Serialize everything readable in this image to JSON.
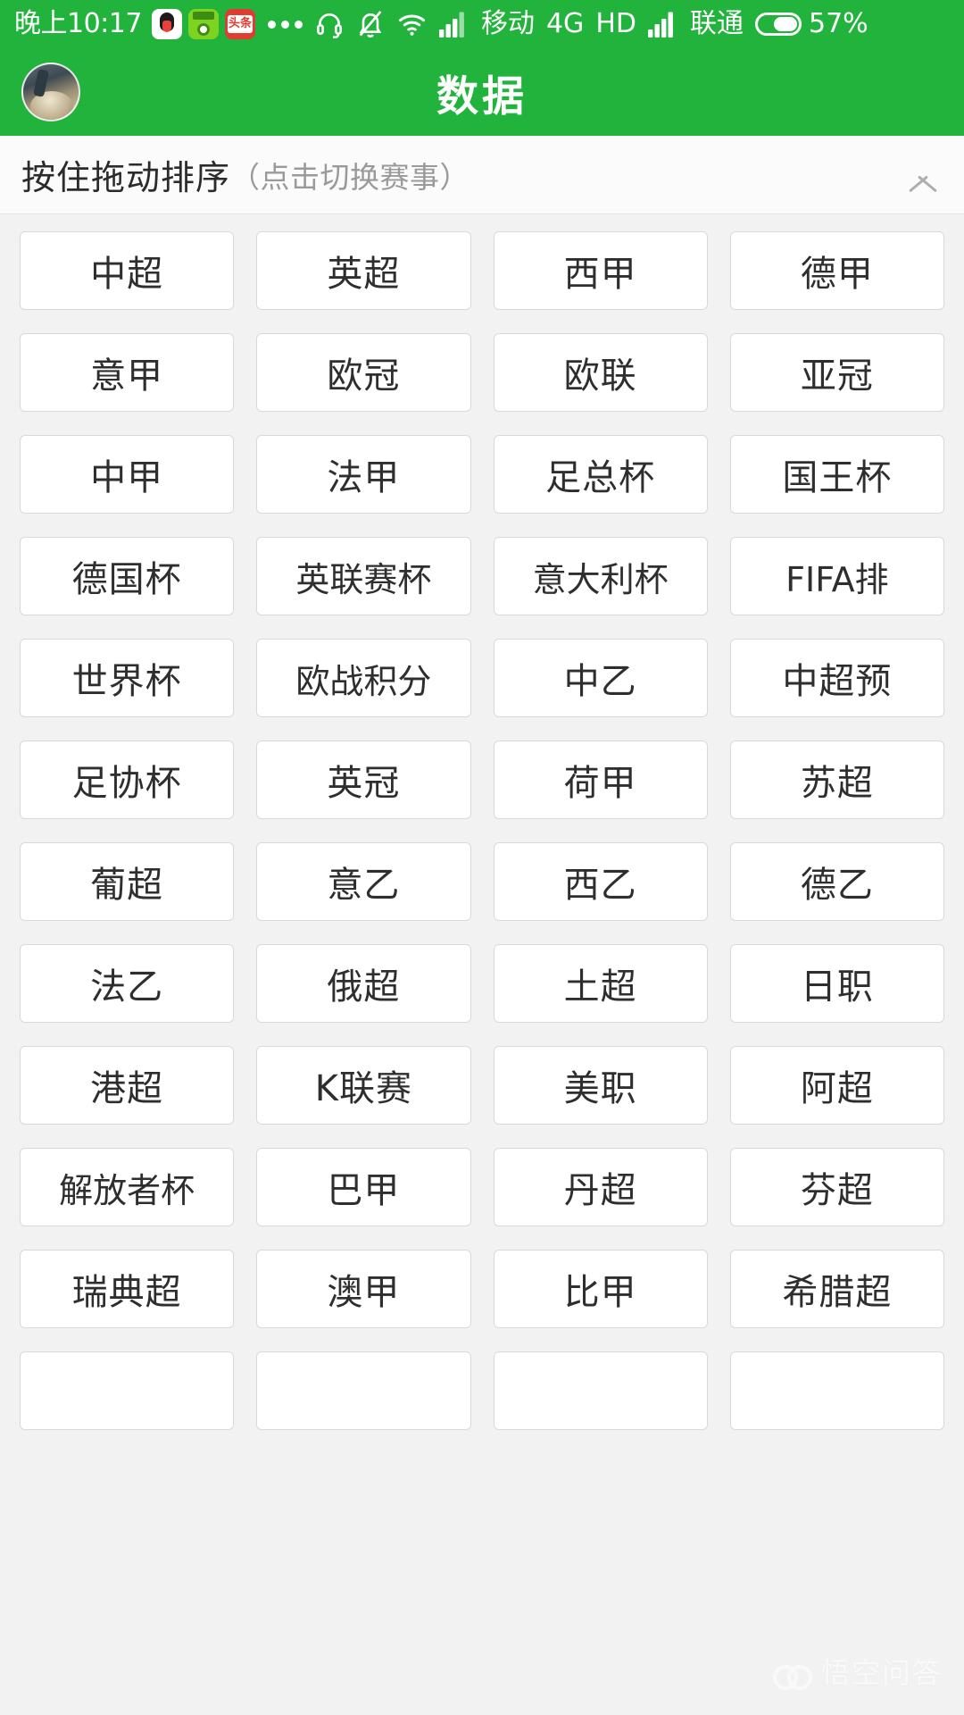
{
  "status_bar": {
    "clock": "晚上10:17",
    "app_icons": [
      "qq-icon",
      "green-app-icon",
      "toutiao-icon"
    ],
    "overflow": "more-dots-icon",
    "headset_icon": "headset-icon",
    "mute_icon": "bell-muted-icon",
    "wifi_icon": "wifi-icon",
    "signal1_icon": "signal-bars-icon",
    "carrier1": "移动",
    "network": "4G",
    "hd": "HD",
    "signal2_icon": "signal-bars-icon",
    "carrier2": "联通",
    "battery_icon": "battery-icon",
    "battery_percent": "57%"
  },
  "app_bar": {
    "avatar": "user-avatar",
    "title": "数据"
  },
  "section_header": {
    "main_label": "按住拖动排序",
    "sub_label": "（点击切换赛事）",
    "collapse_icon": "chevron-up-icon"
  },
  "theme": {
    "brand_green": "#21b33c",
    "page_bg": "#f2f2f2",
    "card_bg": "#ffffff",
    "card_border": "#d9d9d9",
    "text_primary": "#2e2e2e",
    "text_muted": "#9a9a9a"
  },
  "leagues": [
    "中超",
    "英超",
    "西甲",
    "德甲",
    "意甲",
    "欧冠",
    "欧联",
    "亚冠",
    "中甲",
    "法甲",
    "足总杯",
    "国王杯",
    "德国杯",
    "英联赛杯",
    "意大利杯",
    "FIFA排",
    "世界杯",
    "欧战积分",
    "中乙",
    "中超预",
    "足协杯",
    "英冠",
    "荷甲",
    "苏超",
    "葡超",
    "意乙",
    "西乙",
    "德乙",
    "法乙",
    "俄超",
    "土超",
    "日职",
    "港超",
    "K联赛",
    "美职",
    "阿超",
    "解放者杯",
    "巴甲",
    "丹超",
    "芬超",
    "瑞典超",
    "澳甲",
    "比甲",
    "希腊超",
    "",
    "",
    "",
    ""
  ],
  "watermark": {
    "logo": "wukong-logo-icon",
    "text": "悟空问答"
  }
}
